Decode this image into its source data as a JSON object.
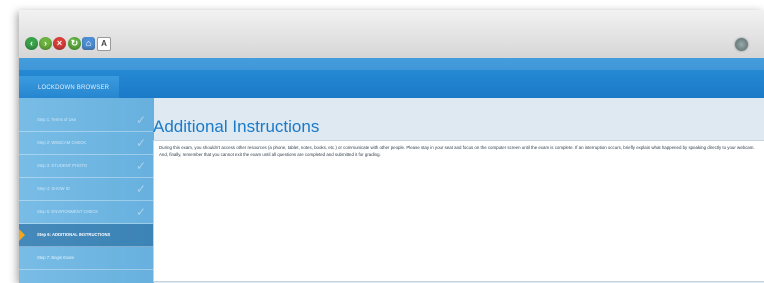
{
  "toolbar": {
    "icons": [
      "back-icon",
      "forward-icon",
      "stop-icon",
      "reload-icon",
      "home-icon",
      "text-size-icon",
      "help-icon"
    ],
    "text_size_label": "A"
  },
  "app": {
    "title": "LOCKDOWN BROWSER"
  },
  "steps": [
    {
      "label": "Step 1:  Terms of Use",
      "state": "done"
    },
    {
      "label": "Step 2:  WEBCAM CHECK",
      "state": "done"
    },
    {
      "label": "Step 3:  STUDENT PHOTO",
      "state": "done"
    },
    {
      "label": "Step 4:  SHOW ID",
      "state": "done"
    },
    {
      "label": "Step 5:  ENVIRONMENT CHECK",
      "state": "done"
    },
    {
      "label": "Step 6:  ADDITIONAL INSTRUCTIONS",
      "state": "active"
    },
    {
      "label": "Step 7:  Begin Exam",
      "state": "pending"
    }
  ],
  "main": {
    "title": "Additional Instructions",
    "instructions": "During this exam, you shouldn't access other resources (a phone, tablet, notes, books, etc.) or communicate with other people. Please stay in your seat and focus on the computer screen until the exam is complete. If an interruption occurs, briefly explain what happened by speaking directly to your webcam. And, finally, remember that you cannot exit the exam until all questions are completed and submitted it for grading."
  },
  "colors": {
    "header": "#1a7ac8",
    "sidebar": "#6fb5e1",
    "active_arrow": "#f3a81c",
    "title": "#1a7ac8"
  }
}
